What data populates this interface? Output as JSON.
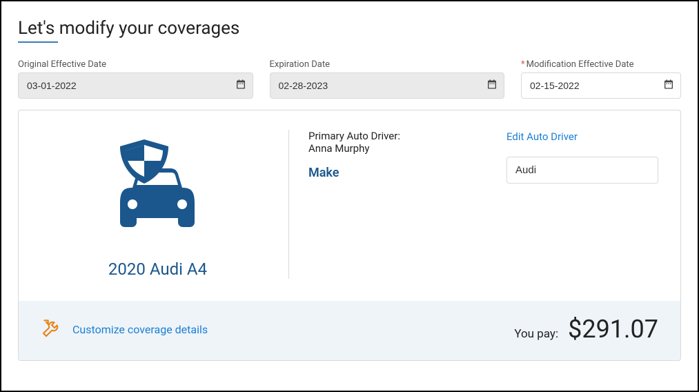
{
  "page": {
    "title": "Let's modify your coverages"
  },
  "dates": {
    "original_label": "Original Effective Date",
    "original_value": "03-01-2022",
    "expiration_label": "Expiration Date",
    "expiration_value": "02-28-2023",
    "modification_label": "Modification Effective Date",
    "modification_value": "02-15-2022"
  },
  "vehicle": {
    "name": "2020 Audi A4",
    "primary_driver_label": "Primary Auto Driver:",
    "primary_driver_name": "Anna Murphy",
    "make_label": "Make",
    "make_value": "Audi",
    "edit_driver_link": "Edit Auto Driver"
  },
  "footer": {
    "customize_link": "Customize coverage details",
    "you_pay_label": "You pay:",
    "amount": "$291.07"
  }
}
